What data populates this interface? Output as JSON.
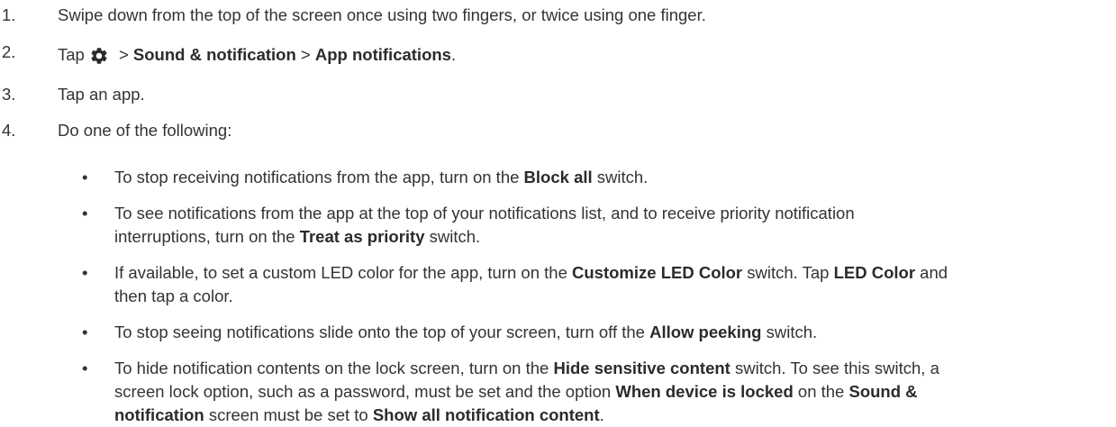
{
  "steps": [
    {
      "num": "1.",
      "text": "Swipe down from the top of the screen once using two fingers, or twice using one finger."
    },
    {
      "num": "2.",
      "pre": "Tap",
      "sep1": " > ",
      "bold1": "Sound & notification",
      "sep2": " > ",
      "bold2": "App notifications",
      "post": ".",
      "icon": "gear-icon"
    },
    {
      "num": "3.",
      "text": "Tap an app."
    },
    {
      "num": "4.",
      "text": "Do one of the following:"
    }
  ],
  "bullets": [
    {
      "dot": "•",
      "line1_pre": "To stop receiving notifications from the app, turn on the ",
      "line1_bold": "Block all",
      "line1_post": " switch."
    },
    {
      "dot": "•",
      "line1": "To see notifications from the app at the top of your notifications list, and to receive priority notification",
      "line2_pre": "interruptions, turn on the ",
      "line2_bold": "Treat as priority",
      "line2_post": " switch."
    },
    {
      "dot": "•",
      "line1_pre": "If available, to set a custom LED color for the app, turn on the ",
      "line1_bold1": "Customize LED Color",
      "line1_mid": " switch. Tap ",
      "line1_bold2": "LED Color",
      "line1_post": " and",
      "line2": "then tap a color."
    },
    {
      "dot": "•",
      "line1_pre": "To stop seeing notifications slide onto the top of your screen, turn off the ",
      "line1_bold": "Allow peeking",
      "line1_post": " switch."
    },
    {
      "dot": "•",
      "line1_pre": "To hide notification contents on the lock screen, turn on the ",
      "line1_bold": "Hide sensitive content",
      "line1_post": " switch. To see this switch, a",
      "line2_pre": "screen lock option, such as a password, must be set and the option ",
      "line2_bold1": "When device is locked",
      "line2_mid": " on the ",
      "line2_bold2": "Sound &",
      "line3_bold1": "notification",
      "line3_mid": " screen must be set to ",
      "line3_bold2": "Show all notification content",
      "line3_post": "."
    }
  ],
  "colors": {
    "text": "#333333",
    "bold": "#2b2b2b",
    "icon": "#2b2b2b"
  }
}
